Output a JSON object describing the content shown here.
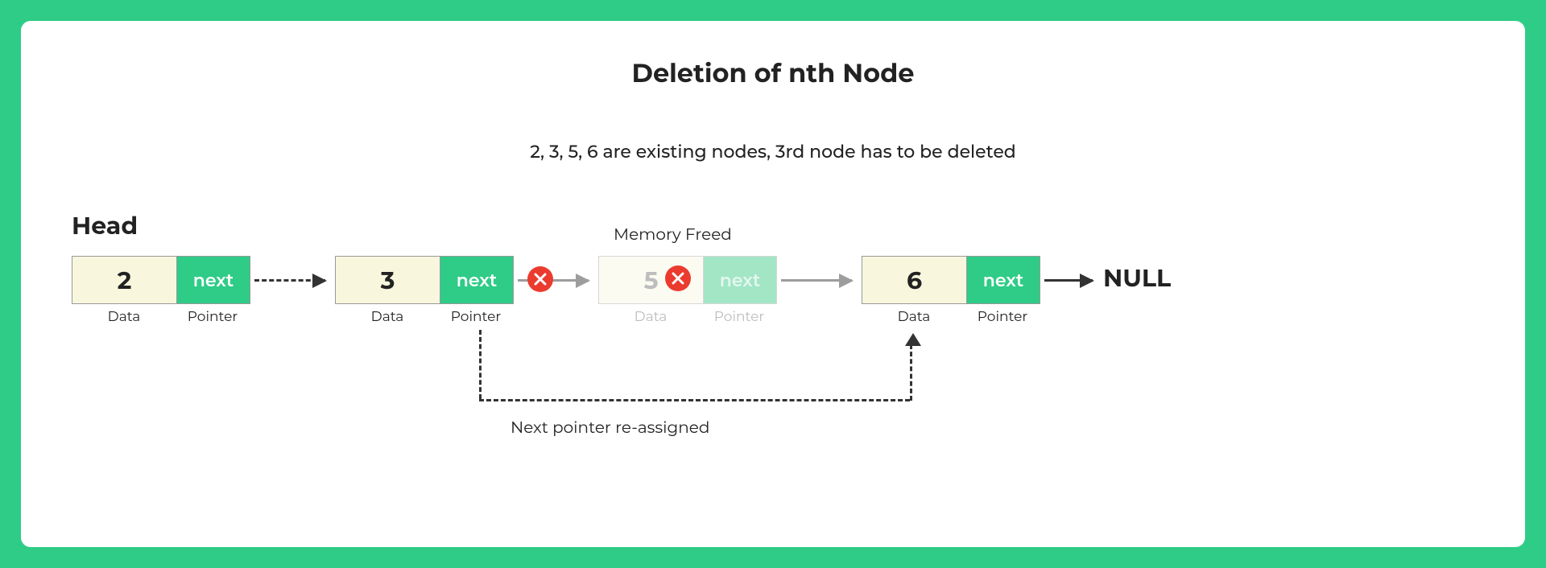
{
  "title": "Deletion of nth Node",
  "subtitle": "2, 3, 5, 6 are existing nodes, 3rd node has to be deleted",
  "labels": {
    "head": "Head",
    "memory_freed": "Memory Freed",
    "null": "NULL",
    "reassigned": "Next pointer re-assigned",
    "data": "Data",
    "pointer": "Pointer",
    "next": "next"
  },
  "nodes": {
    "n1": {
      "value": "2",
      "faded": false
    },
    "n2": {
      "value": "3",
      "faded": false
    },
    "n3": {
      "value": "5",
      "faded": true
    },
    "n4": {
      "value": "6",
      "faded": false
    }
  },
  "arrows": {
    "a12": "dashed-dark",
    "a23": "grey-cancelled",
    "a34": "grey",
    "a4null": "solid-dark",
    "reassign": "dashed-dark"
  }
}
